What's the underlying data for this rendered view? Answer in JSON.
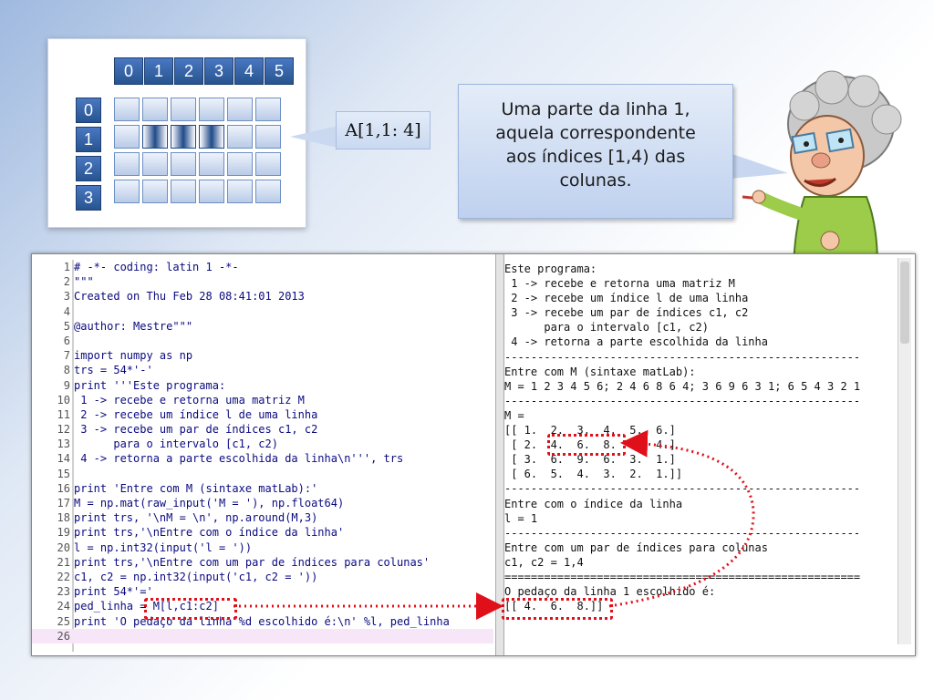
{
  "matrix": {
    "col_headers": [
      "0",
      "1",
      "2",
      "3",
      "4",
      "5"
    ],
    "row_headers": [
      "0",
      "1",
      "2",
      "3"
    ],
    "selected_row": 1,
    "selected_cols": [
      1,
      2,
      3
    ]
  },
  "expr": "A[1,1: 4]",
  "bubble": {
    "line1": "Uma parte da linha 1,",
    "line2": "aquela correspondente",
    "line3": "aos índices [1,4) das",
    "line4": "colunas."
  },
  "editor": {
    "lines": [
      {
        "n": "1",
        "text": "# -*- coding: latin 1 -*-"
      },
      {
        "n": "2",
        "text": "\"\"\""
      },
      {
        "n": "3",
        "text": "Created on Thu Feb 28 08:41:01 2013"
      },
      {
        "n": "4",
        "text": ""
      },
      {
        "n": "5",
        "text": "@author: Mestre\"\"\""
      },
      {
        "n": "6",
        "text": ""
      },
      {
        "n": "7",
        "text": "import numpy as np"
      },
      {
        "n": "8",
        "text": "trs = 54*'-'"
      },
      {
        "n": "9",
        "text": "print '''Este programa:"
      },
      {
        "n": "10",
        "text": " 1 -> recebe e retorna uma matriz M"
      },
      {
        "n": "11",
        "text": " 2 -> recebe um índice l de uma linha"
      },
      {
        "n": "12",
        "text": " 3 -> recebe um par de índices c1, c2"
      },
      {
        "n": "13",
        "text": "      para o intervalo [c1, c2)"
      },
      {
        "n": "14",
        "text": " 4 -> retorna a parte escolhida da linha\\n''', trs"
      },
      {
        "n": "15",
        "text": ""
      },
      {
        "n": "16",
        "text": "print 'Entre com M (sintaxe matLab):'"
      },
      {
        "n": "17",
        "text": "M = np.mat(raw_input('M = '), np.float64)"
      },
      {
        "n": "18",
        "text": "print trs, '\\nM = \\n', np.around(M,3)"
      },
      {
        "n": "19",
        "text": "print trs,'\\nEntre com o índice da linha'"
      },
      {
        "n": "20",
        "text": "l = np.int32(input('l = '))"
      },
      {
        "n": "21",
        "text": "print trs,'\\nEntre com um par de índices para colunas'"
      },
      {
        "n": "22",
        "text": "c1, c2 = np.int32(input('c1, c2 = '))"
      },
      {
        "n": "23",
        "text": "print 54*'='"
      },
      {
        "n": "24",
        "text": "ped_linha = M[l,c1:c2]"
      },
      {
        "n": "25",
        "text": "print 'O pedaço da linha %d escolhido é:\\n' %l, ped_linha"
      },
      {
        "n": "26",
        "text": ""
      }
    ]
  },
  "console": {
    "lines": [
      "Este programa:",
      " 1 -> recebe e retorna uma matriz M",
      " 2 -> recebe um índice l de uma linha",
      " 3 -> recebe um par de índices c1, c2",
      "      para o intervalo [c1, c2)",
      " 4 -> retorna a parte escolhida da linha",
      "------------------------------------------------------",
      "Entre com M (sintaxe matLab):",
      "M = 1 2 3 4 5 6; 2 4 6 8 6 4; 3 6 9 6 3 1; 6 5 4 3 2 1",
      "------------------------------------------------------",
      "M =",
      "[[ 1.  2.  3.  4.  5.  6.]",
      " [ 2.  4.  6.  8.  6.  4.]",
      " [ 3.  6.  9.  6.  3.  1.]",
      " [ 6.  5.  4.  3.  2.  1.]]",
      "------------------------------------------------------",
      "Entre com o índice da linha",
      "l = 1",
      "------------------------------------------------------",
      "Entre com um par de índices para colunas",
      "c1, c2 = 1,4",
      "======================================================",
      "O pedaço da linha 1 escolhido é:",
      "[[ 4.  6.  8.]]"
    ]
  },
  "colors": {
    "accent": "#27548f",
    "highlight": "#e0101a",
    "code": "#0a0a80"
  }
}
